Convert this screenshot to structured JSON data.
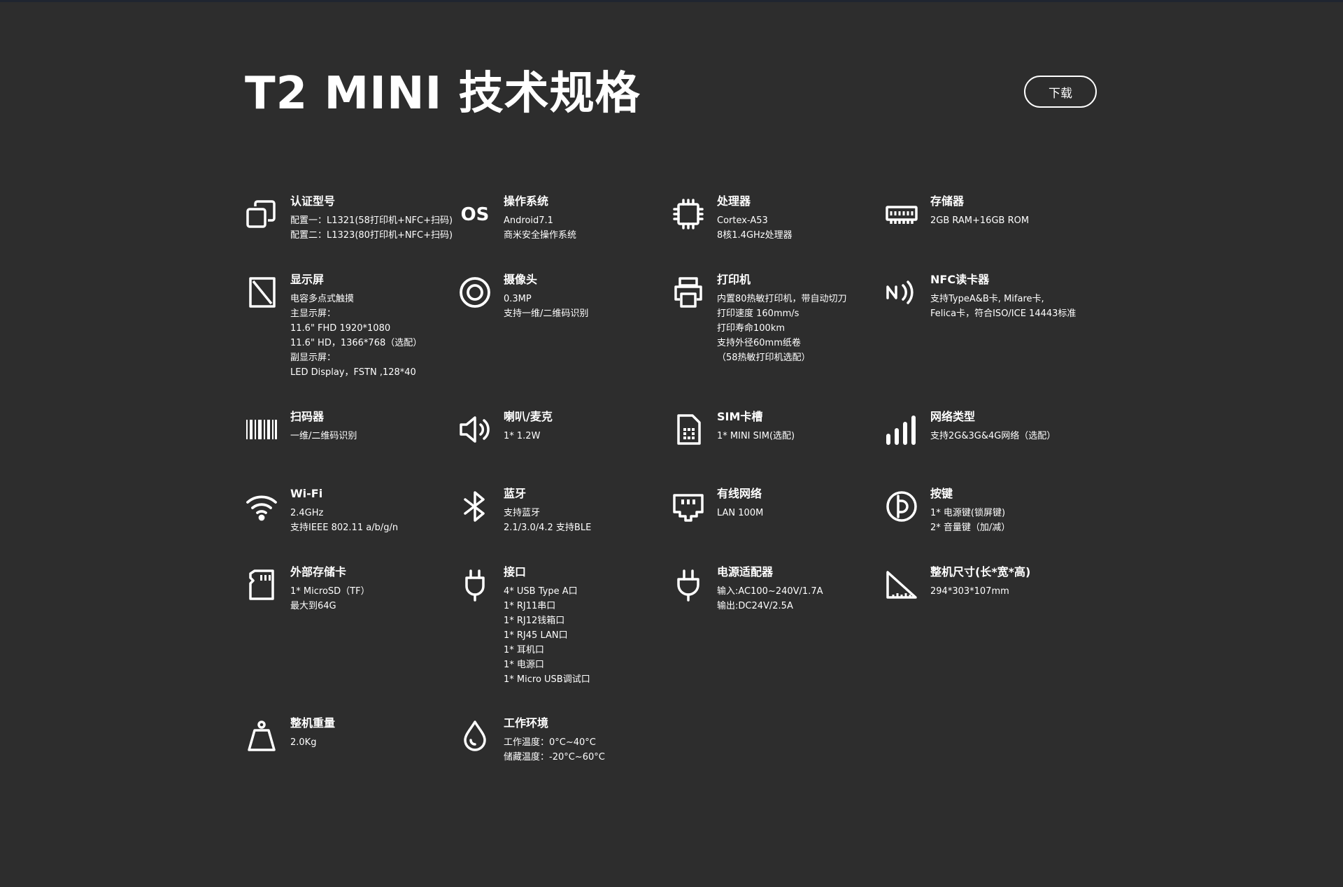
{
  "page": {
    "title": "T2 MINI 技术规格",
    "download_label": "下载"
  },
  "specs": [
    {
      "icon": "copy-icon",
      "title": "认证型号",
      "lines": [
        "配置一：L1321(58打印机+NFC+扫码)",
        "配置二：L1323(80打印机+NFC+扫码)"
      ]
    },
    {
      "icon": "os-icon",
      "icon_text": "OS",
      "title": "操作系统",
      "lines": [
        "Android7.1",
        "商米安全操作系统"
      ]
    },
    {
      "icon": "cpu-chip-icon",
      "title": "处理器",
      "lines": [
        "Cortex-A53",
        "8核1.4GHz处理器"
      ]
    },
    {
      "icon": "memory-icon",
      "title": "存储器",
      "lines": [
        "2GB RAM+16GB ROM"
      ]
    },
    {
      "icon": "display-icon",
      "title": "显示屏",
      "lines": [
        "电容多点式触摸",
        "主显示屏：",
        "11.6\" FHD 1920*1080",
        "11.6\" HD，1366*768（选配）",
        "副显示屏：",
        "LED Display，FSTN ,128*40"
      ]
    },
    {
      "icon": "camera-icon",
      "title": "摄像头",
      "lines": [
        "0.3MP",
        "支持一维/二维码识别"
      ]
    },
    {
      "icon": "printer-icon",
      "title": "打印机",
      "lines": [
        "内置80热敏打印机，带自动切刀",
        "打印速度 160mm/s",
        "打印寿命100km",
        "支持外径60mm纸卷",
        "（58热敏打印机选配）"
      ]
    },
    {
      "icon": "nfc-icon",
      "title": "NFC读卡器",
      "lines": [
        "支持TypeA&B卡, Mifare卡,",
        "Felica卡，符合ISO/ICE 14443标准"
      ]
    },
    {
      "icon": "barcode-icon",
      "title": "扫码器",
      "lines": [
        "一维/二维码识别"
      ]
    },
    {
      "icon": "speaker-icon",
      "title": "喇叭/麦克",
      "lines": [
        "1* 1.2W"
      ]
    },
    {
      "icon": "sim-card-icon",
      "title": "SIM卡槽",
      "lines": [
        "1* MINI SIM(选配)"
      ]
    },
    {
      "icon": "signal-bars-icon",
      "title": "网络类型",
      "lines": [
        "支持2G&3G&4G网络（选配）"
      ]
    },
    {
      "icon": "wifi-icon",
      "title": "Wi-Fi",
      "lines": [
        "2.4GHz",
        "支持IEEE 802.11 a/b/g/n"
      ]
    },
    {
      "icon": "bluetooth-icon",
      "title": "蓝牙",
      "lines": [
        "支持蓝牙",
        "2.1/3.0/4.2 支持BLE"
      ]
    },
    {
      "icon": "ethernet-icon",
      "title": "有线网络",
      "lines": [
        "LAN 100M"
      ]
    },
    {
      "icon": "power-button-icon",
      "title": "按键",
      "lines": [
        "1* 电源键(锁屏键)",
        "2* 音量键（加/减）"
      ]
    },
    {
      "icon": "sd-card-icon",
      "title": "外部存储卡",
      "lines": [
        "1* MicroSD（TF）",
        "最大到64G"
      ]
    },
    {
      "icon": "usb-plug-icon",
      "title": "接口",
      "lines": [
        "4* USB Type A口",
        "1* RJ11串口",
        "1* RJ12钱箱口",
        "1* RJ45 LAN口",
        "1* 耳机口",
        "1* 电源口",
        "1* Micro USB调试口"
      ]
    },
    {
      "icon": "power-plug-icon",
      "title": "电源适配器",
      "lines": [
        "输入:AC100~240V/1.7A",
        "输出:DC24V/2.5A"
      ]
    },
    {
      "icon": "ruler-triangle-icon",
      "title": "整机尺寸(长*宽*高)",
      "lines": [
        "294*303*107mm"
      ]
    },
    {
      "icon": "weight-icon",
      "title": "整机重量",
      "lines": [
        "2.0Kg"
      ]
    },
    {
      "icon": "water-drop-icon",
      "title": "工作环境",
      "lines": [
        "工作温度：0°C~40°C",
        "储藏温度：-20°C~60°C"
      ]
    }
  ]
}
